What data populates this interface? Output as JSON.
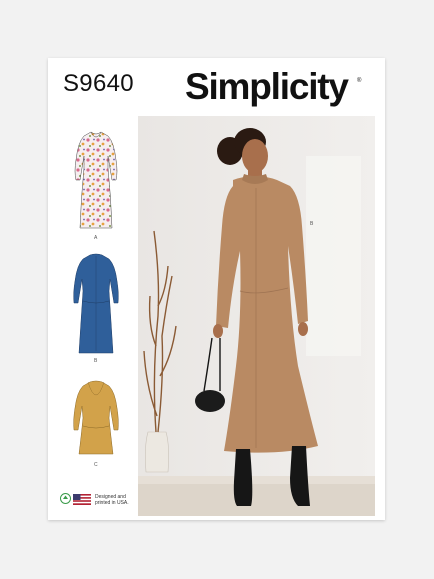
{
  "pattern_number": "S9640",
  "brand": "Simplicity",
  "registered_mark": "®",
  "views": [
    {
      "label": "A"
    },
    {
      "label": "B"
    },
    {
      "label": "C"
    }
  ],
  "photo_view_label": "B",
  "footer": {
    "text": "Designed and printed in USA."
  },
  "colors": {
    "background": "#f2f2f2",
    "dress_b_blue": "#2f5f9a",
    "dress_c_mustard": "#d2a24a",
    "photo_dress_camel": "#b98a63"
  }
}
